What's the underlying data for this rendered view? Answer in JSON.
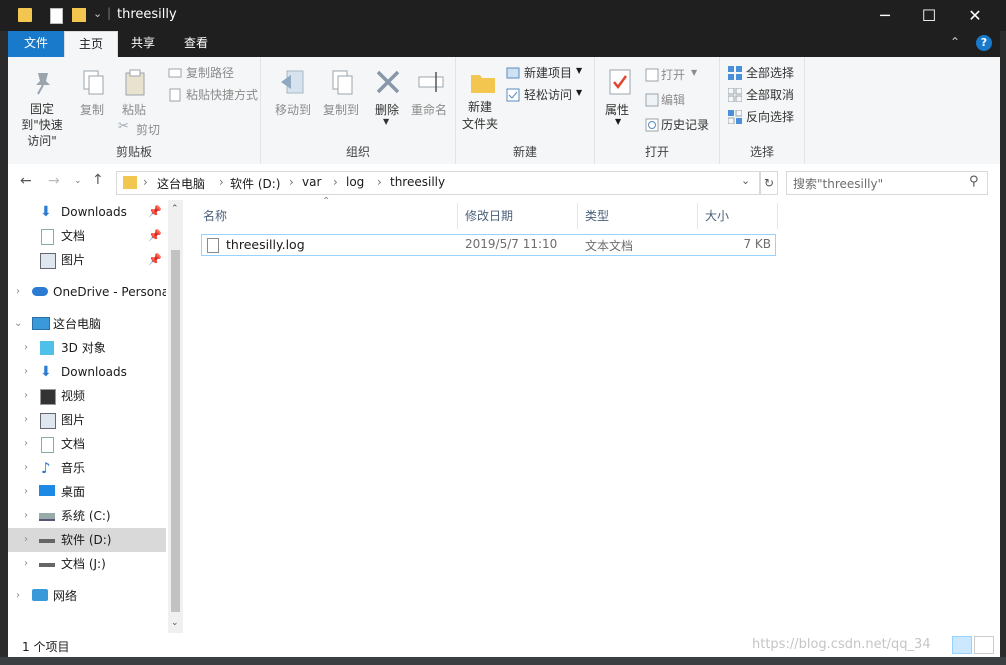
{
  "window": {
    "title": "threesilly"
  },
  "ribbon_tabs": [
    {
      "label": "文件"
    },
    {
      "label": "主页"
    },
    {
      "label": "共享"
    },
    {
      "label": "查看"
    }
  ],
  "ribbon": {
    "clipboard": {
      "pin_label": "固定到\"快速访问\"",
      "copy_label": "复制",
      "paste_label": "粘贴",
      "copy_path_label": "复制路径",
      "paste_shortcut_label": "粘贴快捷方式",
      "cut_label": "剪切",
      "group_label": "剪贴板"
    },
    "organize": {
      "move_to_label": "移动到",
      "copy_to_label": "复制到",
      "delete_label": "删除",
      "rename_label": "重命名",
      "group_label": "组织"
    },
    "new": {
      "new_folder_label": "新建\n文件夹",
      "new_item_label": "新建项目",
      "easy_access_label": "轻松访问",
      "group_label": "新建"
    },
    "open": {
      "properties_label": "属性",
      "open_label": "打开",
      "edit_label": "编辑",
      "history_label": "历史记录",
      "group_label": "打开"
    },
    "select": {
      "select_all_label": "全部选择",
      "select_none_label": "全部取消",
      "invert_label": "反向选择",
      "group_label": "选择"
    }
  },
  "address": {
    "crumbs": [
      "这台电脑",
      "软件 (D:)",
      "var",
      "log",
      "threesilly"
    ],
    "search_placeholder": "搜索\"threesilly\""
  },
  "nav": {
    "quick_access": [
      {
        "label": "Downloads"
      },
      {
        "label": "文档"
      },
      {
        "label": "图片"
      }
    ],
    "onedrive": "OneDrive - Persona",
    "this_pc": "这台电脑",
    "pc_items": [
      {
        "label": "3D 对象"
      },
      {
        "label": "Downloads"
      },
      {
        "label": "视频"
      },
      {
        "label": "图片"
      },
      {
        "label": "文档"
      },
      {
        "label": "音乐"
      },
      {
        "label": "桌面"
      },
      {
        "label": "系统 (C:)"
      },
      {
        "label": "软件 (D:)"
      },
      {
        "label": "文档 (J:)"
      }
    ],
    "network": "网络"
  },
  "columns": {
    "name": "名称",
    "modified": "修改日期",
    "type": "类型",
    "size": "大小"
  },
  "files": [
    {
      "name": "threesilly.log",
      "modified": "2019/5/7 11:10",
      "type": "文本文档",
      "size": "7 KB"
    }
  ],
  "status": {
    "count": "1 个项目"
  },
  "watermark": "https://blog.csdn.net/qq_34",
  "colors": {
    "accent": "#1979ca",
    "selected": "#cce8ff",
    "titlebar": "#1f1f1f"
  }
}
